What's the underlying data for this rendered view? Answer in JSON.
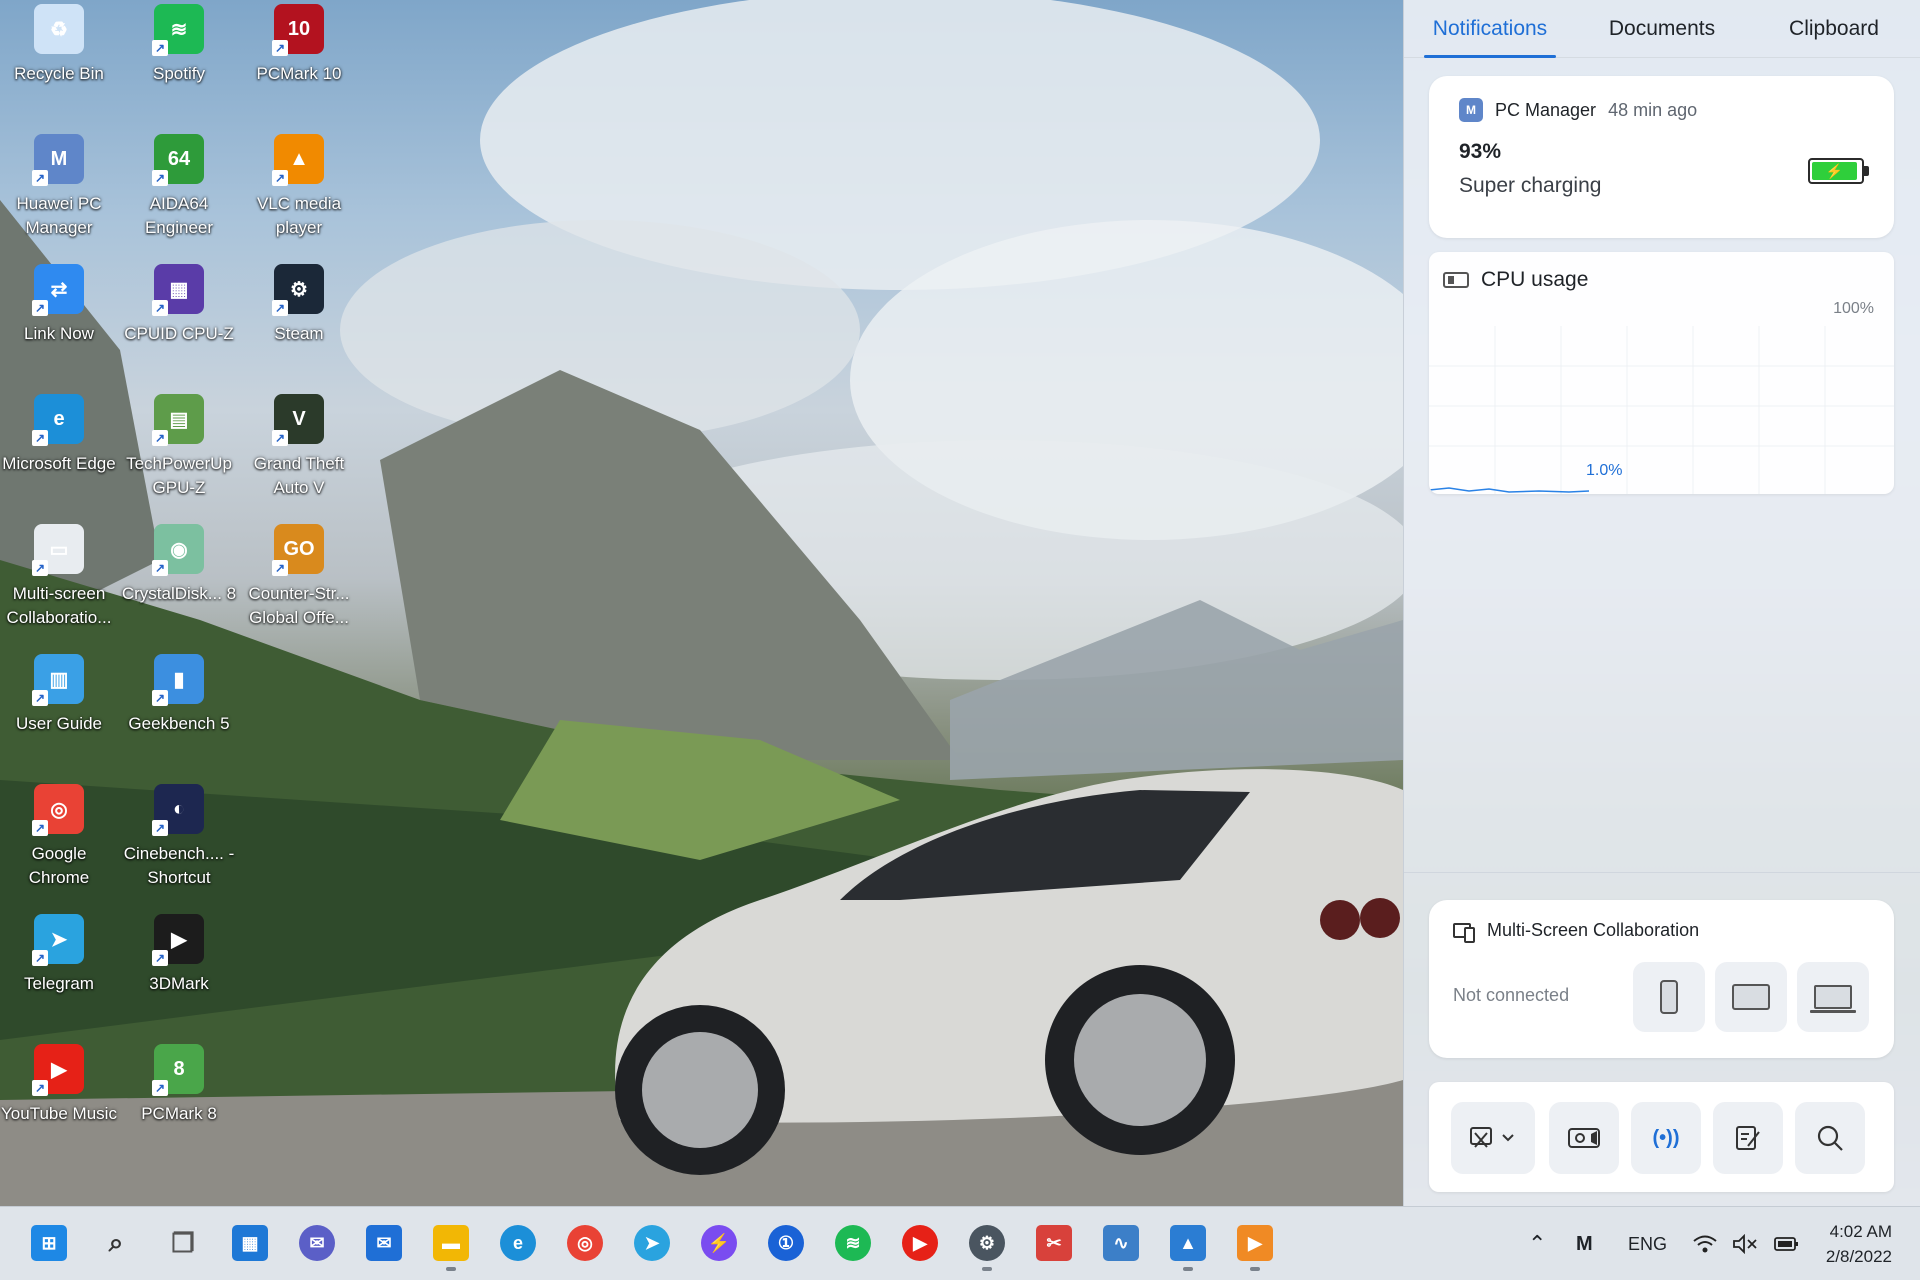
{
  "panel": {
    "tabs": [
      "Notifications",
      "Documents",
      "Clipboard"
    ],
    "notification": {
      "app_name": "PC Manager",
      "time": "48 min ago",
      "battery_percent": "93%",
      "battery_level": 0.93,
      "status": "Super charging",
      "accent": "#1f6fd6",
      "battery_color": "#2fcf3b"
    },
    "cpu": {
      "title": "CPU usage",
      "max_label": "100%",
      "current_label": "1.0%"
    },
    "multiscreen": {
      "title": "Multi-Screen Collaboration",
      "status": "Not connected",
      "devices": [
        "phone-icon",
        "tablet-icon",
        "laptop-icon"
      ]
    },
    "tools": [
      "screenshot-icon",
      "screen-record-icon",
      "wireless-projection-icon",
      "notes-icon",
      "search-icon"
    ]
  },
  "desktop_icons": [
    {
      "label": "Recycle Bin",
      "icon": "recycle-bin-icon",
      "color": "#cfe3f7",
      "glyph": "♻"
    },
    {
      "label": "Spotify",
      "icon": "spotify-icon",
      "color": "#1db954",
      "glyph": "≋"
    },
    {
      "label": "PCMark 10",
      "icon": "pcmark10-icon",
      "color": "#b3121f",
      "glyph": "10"
    },
    {
      "label": "Huawei PC Manager",
      "icon": "huawei-pc-manager-icon",
      "color": "#5f86c9",
      "glyph": "M"
    },
    {
      "label": "AIDA64 Engineer",
      "icon": "aida64-icon",
      "color": "#2e9b3a",
      "glyph": "64"
    },
    {
      "label": "VLC media player",
      "icon": "vlc-icon",
      "color": "#f18a00",
      "glyph": "▲"
    },
    {
      "label": "Link Now",
      "icon": "link-now-icon",
      "color": "#2f8af0",
      "glyph": "⇄"
    },
    {
      "label": "CPUID CPU-Z",
      "icon": "cpu-z-icon",
      "color": "#5a3ca8",
      "glyph": "▦"
    },
    {
      "label": "Steam",
      "icon": "steam-icon",
      "color": "#1b2838",
      "glyph": "⚙"
    },
    {
      "label": "Microsoft Edge",
      "icon": "edge-icon",
      "color": "#1c8fd8",
      "glyph": "e"
    },
    {
      "label": "TechPowerUp GPU-Z",
      "icon": "gpu-z-icon",
      "color": "#5e9c4a",
      "glyph": "▤"
    },
    {
      "label": "Grand Theft Auto V",
      "icon": "gta-v-icon",
      "color": "#2b3a2a",
      "glyph": "V"
    },
    {
      "label": "Multi-screen Collaboratio...",
      "icon": "multi-screen-icon",
      "color": "#e8ecf0",
      "glyph": "▭"
    },
    {
      "label": "CrystalDisk... 8",
      "icon": "crystaldisk-icon",
      "color": "#7cc0a0",
      "glyph": "◉"
    },
    {
      "label": "Counter-Str... Global Offe...",
      "icon": "csgo-icon",
      "color": "#d98a1d",
      "glyph": "GO"
    },
    {
      "label": "User Guide",
      "icon": "user-guide-icon",
      "color": "#3aa0e6",
      "glyph": "▥"
    },
    {
      "label": "Geekbench 5",
      "icon": "geekbench-icon",
      "color": "#3c8fe0",
      "glyph": "▮"
    },
    {
      "label": "Google Chrome",
      "icon": "chrome-icon",
      "color": "#e94235",
      "glyph": "◎"
    },
    {
      "label": "Cinebench.... - Shortcut",
      "icon": "cinebench-icon",
      "color": "#1d2750",
      "glyph": "◐"
    },
    {
      "label": "Telegram",
      "icon": "telegram-icon",
      "color": "#2aa3df",
      "glyph": "➤"
    },
    {
      "label": "3DMark",
      "icon": "3dmark-icon",
      "color": "#1c1c1c",
      "glyph": "▶"
    },
    {
      "label": "YouTube Music",
      "icon": "youtube-music-icon",
      "color": "#e62117",
      "glyph": "▶"
    },
    {
      "label": "PCMark 8",
      "icon": "pcmark8-icon",
      "color": "#4aa64a",
      "glyph": "8"
    }
  ],
  "taskbar": {
    "apps": [
      {
        "icon": "windows-start-icon",
        "color": "#1e88e5",
        "open": false
      },
      {
        "icon": "search-icon",
        "color": "#333333",
        "open": false
      },
      {
        "icon": "task-view-icon",
        "color": "#555555",
        "open": false
      },
      {
        "icon": "widgets-icon",
        "color": "#1e78d6",
        "open": false
      },
      {
        "icon": "teams-chat-icon",
        "color": "#5b5fc7",
        "open": false
      },
      {
        "icon": "mail-icon",
        "color": "#1f6fd6",
        "open": false
      },
      {
        "icon": "file-explorer-icon",
        "color": "#f2b705",
        "open": true
      },
      {
        "icon": "edge-icon",
        "color": "#1c8fd8",
        "open": false
      },
      {
        "icon": "chrome-icon",
        "color": "#e94235",
        "open": false
      },
      {
        "icon": "telegram-icon",
        "color": "#2aa3df",
        "open": false
      },
      {
        "icon": "messenger-icon",
        "color": "#7a4cf0",
        "open": false
      },
      {
        "icon": "1password-icon",
        "color": "#1a62d6",
        "open": false
      },
      {
        "icon": "spotify-icon",
        "color": "#1db954",
        "open": false
      },
      {
        "icon": "youtube-music-icon",
        "color": "#e62117",
        "open": false
      },
      {
        "icon": "settings-icon",
        "color": "#4a5560",
        "open": true
      },
      {
        "icon": "snipping-tool-icon",
        "color": "#d8413b",
        "open": false
      },
      {
        "icon": "performance-monitor-icon",
        "color": "#3c7fc8",
        "open": false
      },
      {
        "icon": "photos-icon",
        "color": "#2b7dd3",
        "open": true
      },
      {
        "icon": "3dmark-icon",
        "color": "#f08a24",
        "open": true
      }
    ],
    "language": "ENG",
    "time": "4:02 AM",
    "date": "2/8/2022"
  }
}
